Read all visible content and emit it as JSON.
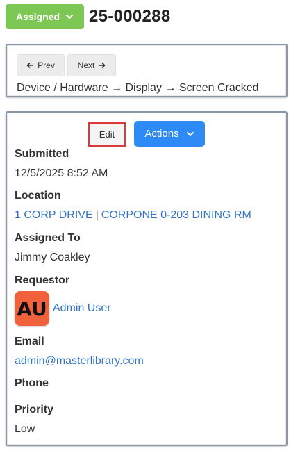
{
  "header": {
    "status_label": "Assigned",
    "status_color": "#7dc855",
    "ticket_number": "25-000288"
  },
  "navigation": {
    "prev_label": "Prev",
    "next_label": "Next",
    "category_path": "Device / Hardware → Display → Screen Cracked"
  },
  "toolbar": {
    "edit_label": "Edit",
    "actions_label": "Actions",
    "actions_color": "#2e8af5"
  },
  "details": {
    "submitted_label": "Submitted",
    "submitted_value": "12/5/2025 8:52 AM",
    "location_label": "Location",
    "location_site": "1 CORP DRIVE",
    "location_separator": "|",
    "location_room": "CORPONE 0-203 DINING RM",
    "assigned_label": "Assigned To",
    "assigned_value": "Jimmy Coakley",
    "requestor_label": "Requestor",
    "requestor_initials": "AU",
    "requestor_name": "Admin User",
    "email_label": "Email",
    "email_value": "admin@masterlibrary.com",
    "phone_label": "Phone",
    "priority_label": "Priority",
    "priority_value": "Low"
  }
}
